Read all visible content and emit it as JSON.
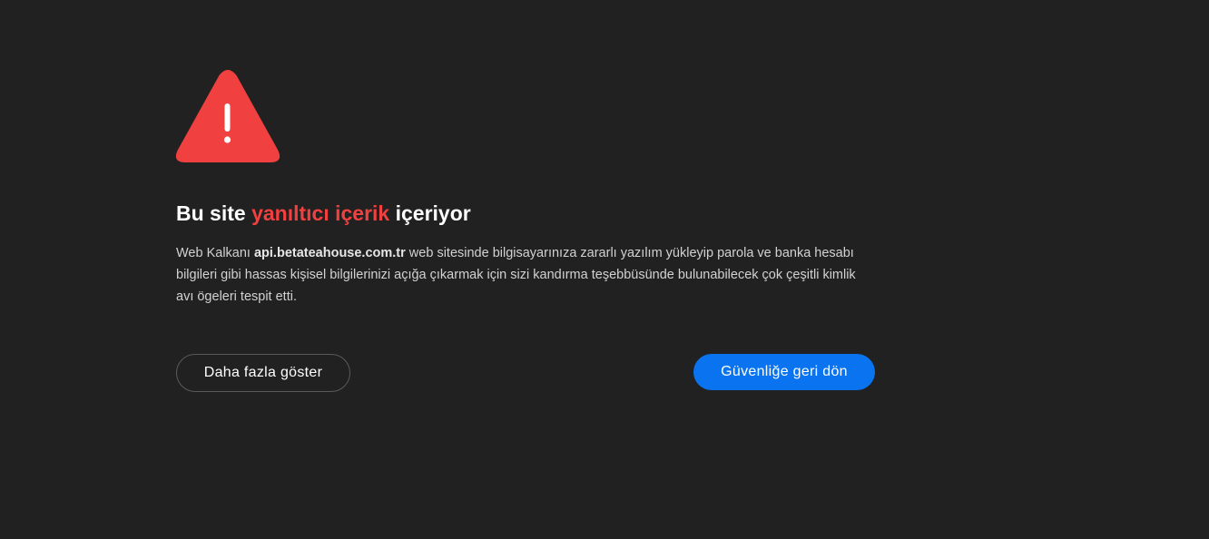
{
  "colors": {
    "background": "#212121",
    "accent_red": "#f04040",
    "primary_button": "#0a74f0",
    "text": "#ffffff"
  },
  "icon": "warning-triangle-icon",
  "title": {
    "prefix": "Bu site ",
    "highlight": "yanıltıcı içerik",
    "suffix": " içeriyor"
  },
  "description": {
    "before_domain": "Web Kalkanı ",
    "domain": "api.betateahouse.com.tr",
    "after_domain": " web sitesinde bilgisayarınıza zararlı yazılım yükleyip parola ve banka hesabı bilgileri gibi hassas kişisel bilgilerinizi açığa çıkarmak için sizi kandırma teşebbüsünde bulunabilecek çok çeşitli kimlik avı ögeleri tespit etti."
  },
  "buttons": {
    "show_more": "Daha fazla göster",
    "back_to_safety": "Güvenliğe geri dön"
  }
}
